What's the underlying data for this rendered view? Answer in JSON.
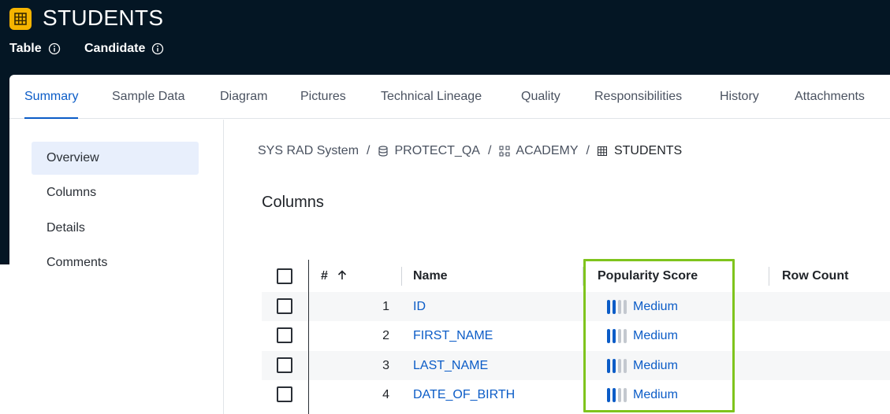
{
  "header": {
    "title": "STUDENTS",
    "icon": "table-icon",
    "meta": [
      {
        "label": "Table",
        "icon": "info-icon"
      },
      {
        "label": "Candidate",
        "icon": "info-icon"
      }
    ],
    "accent_color": "#f5b400"
  },
  "tabs": [
    {
      "label": "Summary"
    },
    {
      "label": "Sample Data"
    },
    {
      "label": "Diagram"
    },
    {
      "label": "Pictures"
    },
    {
      "label": "Technical Lineage"
    },
    {
      "label": "Quality"
    },
    {
      "label": "Responsibilities"
    },
    {
      "label": "History"
    },
    {
      "label": "Attachments"
    }
  ],
  "active_tab": "Summary",
  "sidebar": {
    "items": [
      {
        "label": "Overview"
      },
      {
        "label": "Columns"
      },
      {
        "label": "Details"
      },
      {
        "label": "Comments"
      }
    ],
    "active": "Overview"
  },
  "breadcrumb": {
    "items": [
      {
        "label": "SYS RAD System",
        "icon": ""
      },
      {
        "label": "PROTECT_QA",
        "icon": "database-icon"
      },
      {
        "label": "ACADEMY",
        "icon": "schema-icon"
      },
      {
        "label": "STUDENTS",
        "icon": "table-icon"
      }
    ],
    "separator": "/"
  },
  "section": {
    "title": "Columns"
  },
  "table": {
    "headers": {
      "number": "#",
      "sort_icon": "arrow-up-icon",
      "name": "Name",
      "popularity": "Popularity Score",
      "row_count": "Row Count"
    },
    "rows": [
      {
        "num": "1",
        "name": "ID",
        "popularity": "Medium",
        "popularity_level": 2
      },
      {
        "num": "2",
        "name": "FIRST_NAME",
        "popularity": "Medium",
        "popularity_level": 2
      },
      {
        "num": "3",
        "name": "LAST_NAME",
        "popularity": "Medium",
        "popularity_level": 2
      },
      {
        "num": "4",
        "name": "DATE_OF_BIRTH",
        "popularity": "Medium",
        "popularity_level": 2
      }
    ],
    "popularity_max": 4
  },
  "colors": {
    "header_bg": "#041624",
    "link": "#0b5cc7",
    "bar_on": "#0b5cc7",
    "bar_off": "#c3c8cf",
    "highlight": "#7fc41d"
  }
}
